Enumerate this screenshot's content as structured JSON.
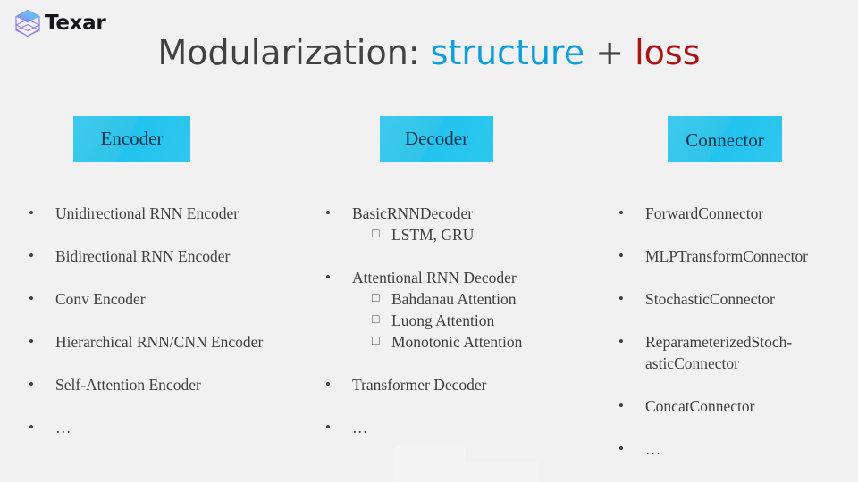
{
  "brand": {
    "name": "Texar",
    "logo_icon": "cube-stack-icon",
    "gradient_from": "#9b7bf0",
    "gradient_to": "#3fd6e8"
  },
  "title": {
    "part1": "Modularization: ",
    "structure": "structure",
    "plus": " + ",
    "loss": "loss",
    "color_default": "#414141",
    "color_structure": "#0d9fdc",
    "color_loss": "#ab1414"
  },
  "columns": [
    {
      "id": "encoder",
      "header": "Encoder",
      "header_bg": "#2fc5ec",
      "items": [
        {
          "text": "Unidirectional RNN Encoder",
          "sub": []
        },
        {
          "text": "Bidirectional RNN Encoder",
          "sub": []
        },
        {
          "text": "Conv Encoder",
          "sub": []
        },
        {
          "text": "Hierarchical RNN/CNN Encoder",
          "sub": []
        },
        {
          "text": "Self-Attention Encoder",
          "sub": []
        },
        {
          "text": "…",
          "sub": []
        }
      ]
    },
    {
      "id": "decoder",
      "header": "Decoder",
      "header_bg": "#2fc5ec",
      "items": [
        {
          "text": "BasicRNNDecoder",
          "sub": [
            "LSTM, GRU"
          ]
        },
        {
          "text": "Attentional RNN Decoder",
          "sub": [
            "Bahdanau Attention",
            "Luong Attention",
            "Monotonic Attention"
          ]
        },
        {
          "text": "Transformer Decoder",
          "sub": []
        },
        {
          "text": "…",
          "sub": []
        }
      ]
    },
    {
      "id": "connector",
      "header": "Connector",
      "header_bg": "#2fc5ec",
      "items": [
        {
          "text": "ForwardConnector",
          "sub": []
        },
        {
          "text": "MLPTransformConnector",
          "sub": []
        },
        {
          "text": "StochasticConnector",
          "sub": []
        },
        {
          "text": "ReparameterizedStoch-asticConnector",
          "sub": []
        },
        {
          "text": "ConcatConnector",
          "sub": []
        },
        {
          "text": "…",
          "sub": []
        }
      ]
    }
  ],
  "markers": {
    "bullet": "•",
    "square": "□"
  }
}
